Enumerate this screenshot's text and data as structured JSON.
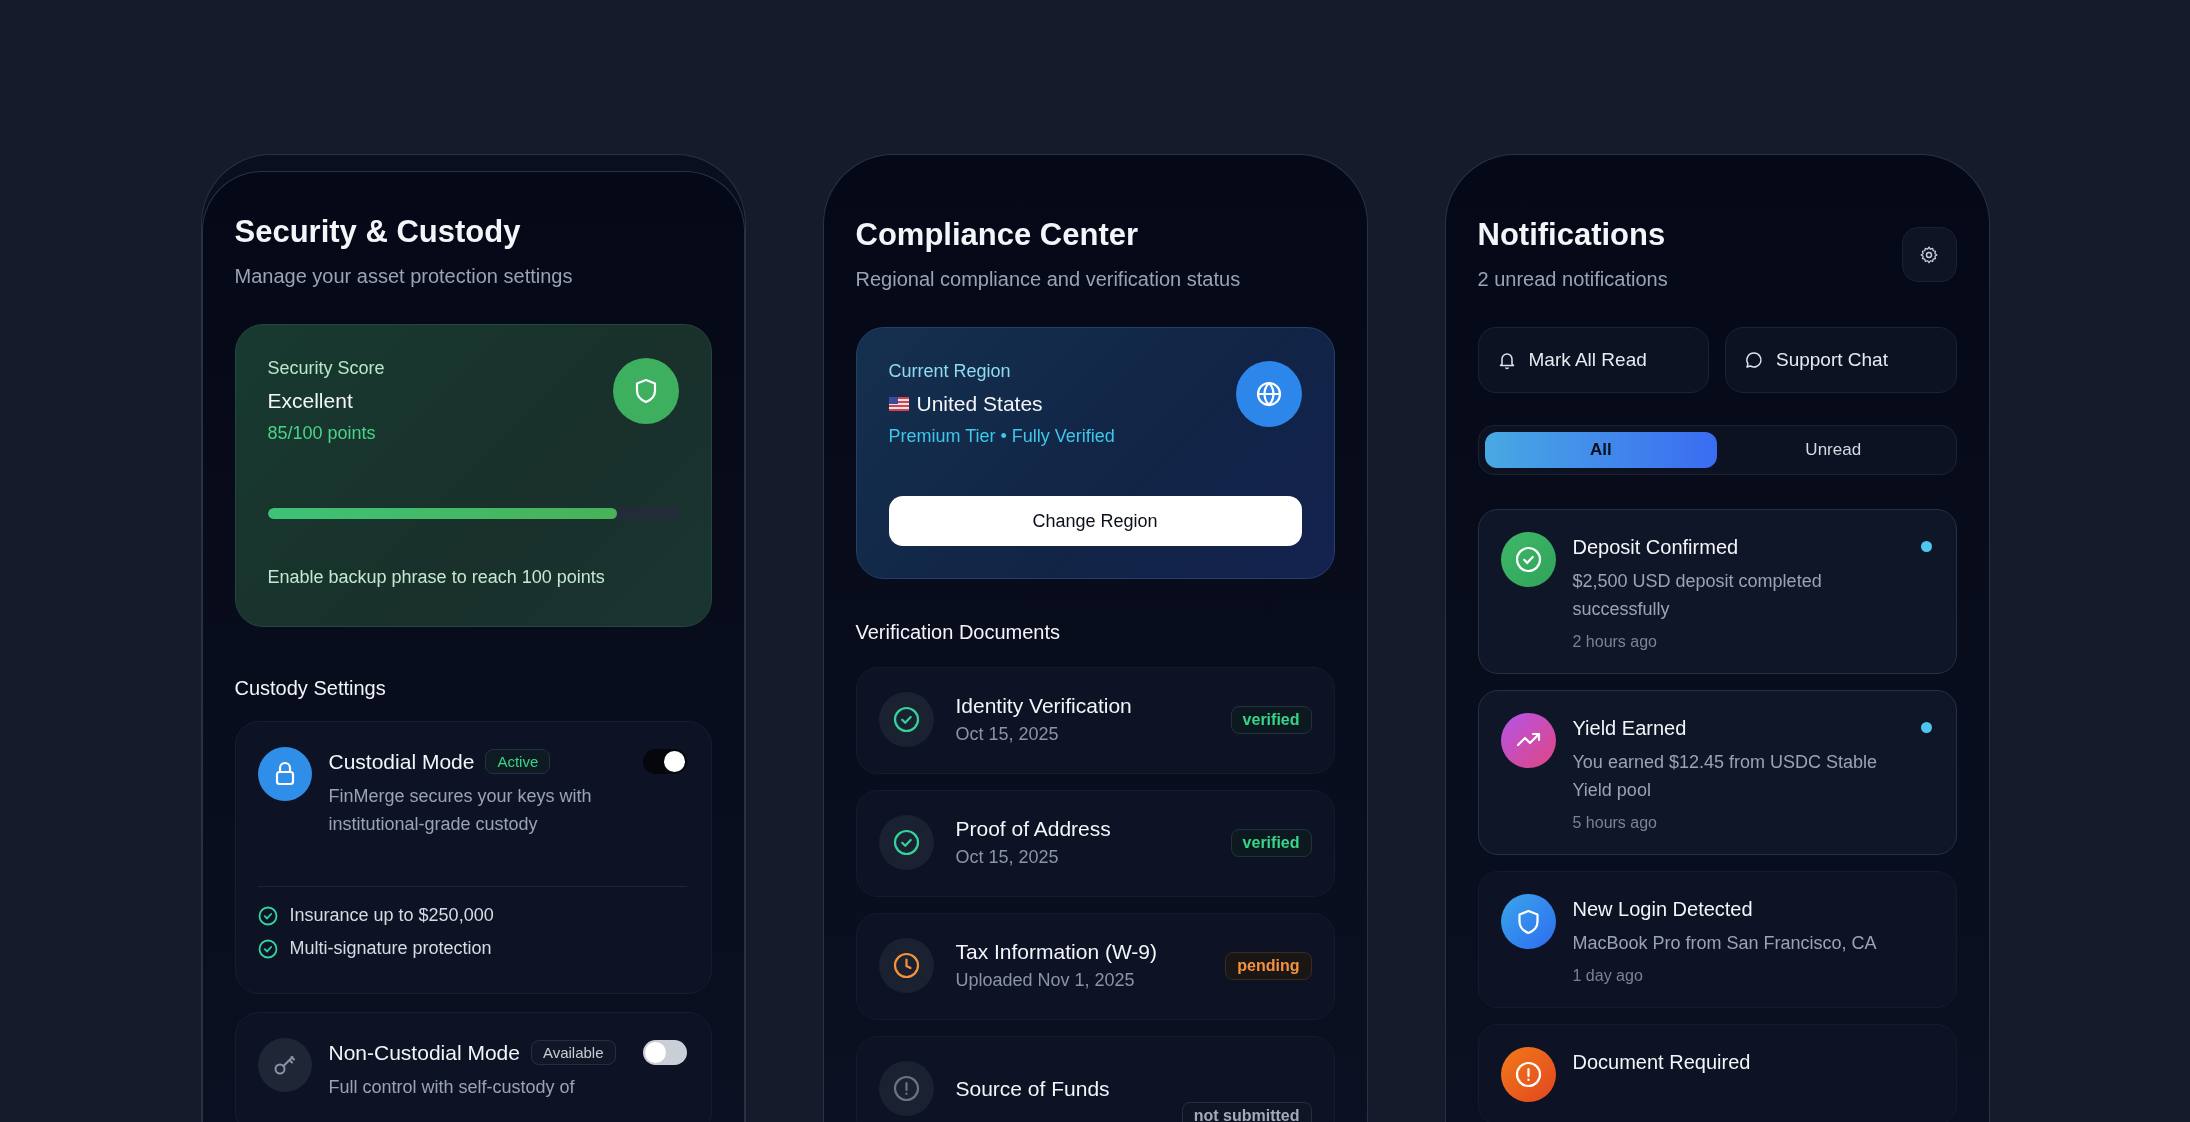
{
  "security": {
    "title": "Security & Custody",
    "subtitle": "Manage your asset protection settings",
    "score": {
      "label": "Security Score",
      "rating": "Excellent",
      "points": "85/100 points",
      "level": 0.85,
      "hint": "Enable backup phrase to reach 100 points"
    },
    "section_title": "Custody Settings",
    "modes": [
      {
        "kind": "lock",
        "name": "Custodial Mode",
        "badge": "Active",
        "on": true,
        "description": "FinMerge secures your keys with institutional-grade custody",
        "features": [
          "Insurance up to $250,000",
          "Multi-signature protection"
        ]
      },
      {
        "kind": "key",
        "name": "Non-Custodial Mode",
        "badge": "Available",
        "on": false,
        "description": "Full control with self-custody of"
      }
    ]
  },
  "compliance": {
    "title": "Compliance Center",
    "subtitle": "Regional compliance and verification status",
    "region": {
      "label": "Current Region",
      "name": "United States",
      "tier": "Premium Tier • Fully Verified",
      "button": "Change Region"
    },
    "section_title": "Verification Documents",
    "documents": [
      {
        "kind": "verified",
        "name": "Identity Verification",
        "date": "Oct 15, 2025",
        "status": "verified"
      },
      {
        "kind": "verified",
        "name": "Proof of Address",
        "date": "Oct 15, 2025",
        "status": "verified"
      },
      {
        "kind": "pending",
        "name": "Tax Information (W-9)",
        "date": "Uploaded Nov 1, 2025",
        "status": "pending"
      },
      {
        "kind": "missing",
        "name": "Source of Funds",
        "status": "not submitted"
      }
    ]
  },
  "notifications": {
    "title": "Notifications",
    "subtitle": "2 unread notifications",
    "actions": [
      {
        "kind": "bell",
        "label": "Mark All Read"
      },
      {
        "kind": "chat",
        "label": "Support Chat"
      }
    ],
    "filters": [
      {
        "label": "All",
        "selected": true
      },
      {
        "label": "Unread",
        "selected": false
      }
    ],
    "items": [
      {
        "kind": "deposit",
        "title": "Deposit Confirmed",
        "message": "$2,500 USD deposit completed successfully",
        "time": "2 hours ago",
        "unread": true
      },
      {
        "kind": "yield",
        "title": "Yield Earned",
        "message": "You earned $12.45 from USDC Stable Yield pool",
        "time": "5 hours ago",
        "unread": true
      },
      {
        "kind": "login",
        "title": "New Login Detected",
        "message": "MacBook Pro from San Francisco, CA",
        "time": "1 day ago",
        "unread": false
      },
      {
        "kind": "document",
        "title": "Document Required",
        "unread": false
      }
    ]
  }
}
